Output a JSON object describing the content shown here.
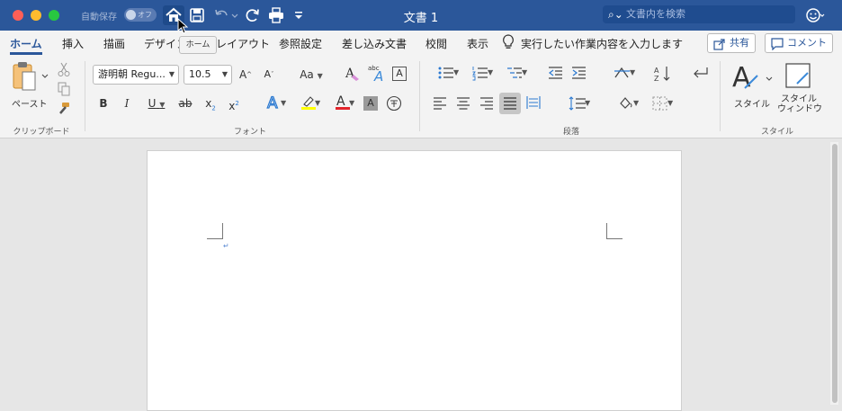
{
  "titlebar": {
    "autosave_label": "自動保存",
    "autosave_state": "オフ",
    "doc_title": "文書 1",
    "search_placeholder": "文書内を検索"
  },
  "tooltip": "ホーム",
  "tabs": [
    {
      "label": "ホーム",
      "active": true
    },
    {
      "label": "挿入"
    },
    {
      "label": "描画"
    },
    {
      "label": "デザイン"
    },
    {
      "label": "レイアウト"
    },
    {
      "label": "参照設定"
    },
    {
      "label": "差し込み文書"
    },
    {
      "label": "校閲"
    },
    {
      "label": "表示"
    }
  ],
  "tell_me": "実行したい作業内容を入力します",
  "share_label": "共有",
  "comment_label": "コメント",
  "ribbon": {
    "clipboard": {
      "paste_label": "ペースト",
      "group_label": "クリップボード"
    },
    "font": {
      "font_name": "游明朝 Regu...",
      "font_size": "10.5",
      "group_label": "フォント",
      "grow": "A",
      "shrink": "A",
      "case": "Aa",
      "bold": "B",
      "italic": "I",
      "underline": "U",
      "strike": "ab",
      "subscript": "x",
      "superscript": "x",
      "sub_mark": "2",
      "sup_mark": "2",
      "phonetic": "abc",
      "font_color_letter": "A",
      "highlight_color": "#ffff00",
      "font_color": "#e3242b"
    },
    "paragraph": {
      "group_label": "段落"
    },
    "styles": {
      "style_label": "スタイル",
      "style_pane_label_1": "スタイル",
      "style_pane_label_2": "ウィンドウ",
      "group_label": "スタイル"
    }
  },
  "colors": {
    "brand": "#2b579a"
  }
}
